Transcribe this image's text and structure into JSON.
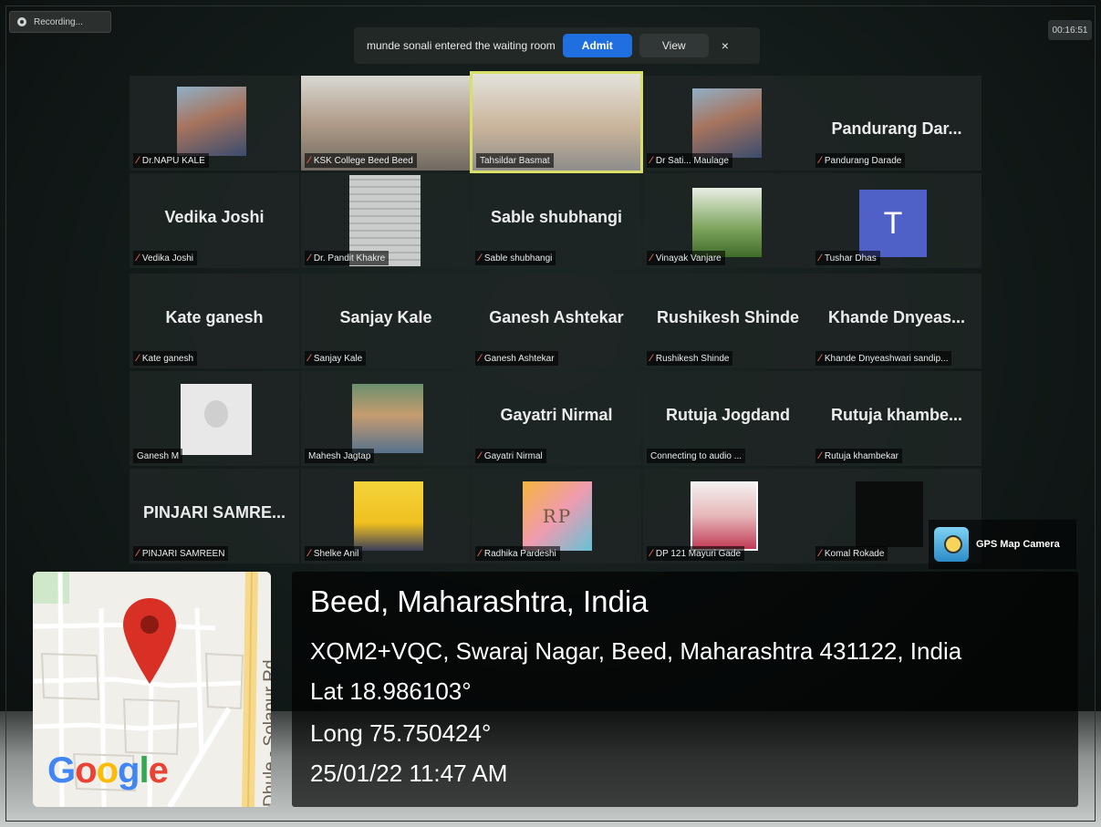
{
  "recording": {
    "label": "Recording..."
  },
  "timer": "00:16:51",
  "waiting_room": {
    "message": "munde sonali entered the waiting room",
    "admit_label": "Admit",
    "view_label": "View",
    "close_symbol": "×"
  },
  "participants": [
    {
      "label": "Dr.NAPU KALE",
      "muted": true
    },
    {
      "label": "KSK College Beed Beed",
      "muted": true
    },
    {
      "label": "Tahsildar Basmat",
      "muted": false,
      "active_speaker": true
    },
    {
      "label": "Dr Sati... Maulage",
      "muted": true
    },
    {
      "big_name": "Pandurang  Dar...",
      "label": "Pandurang Darade",
      "muted": true
    },
    {
      "big_name": "Vedika Joshi",
      "label": "Vedika Joshi",
      "muted": true
    },
    {
      "label": "Dr. Pandit Khakre",
      "muted": true
    },
    {
      "big_name": "Sable shubhangi",
      "label": "Sable shubhangi",
      "muted": true
    },
    {
      "label": "Vinayak Vanjare",
      "muted": true
    },
    {
      "avatar_letter": "T",
      "label": "Tushar Dhas",
      "muted": true
    },
    {
      "big_name": "Kate ganesh",
      "label": "Kate ganesh",
      "muted": true
    },
    {
      "big_name": "Sanjay Kale",
      "label": "Sanjay Kale",
      "muted": true
    },
    {
      "big_name": "Ganesh Ashtekar",
      "label": "Ganesh Ashtekar",
      "muted": true
    },
    {
      "big_name": "Rushikesh Shinde",
      "label": "Rushikesh Shinde",
      "muted": true
    },
    {
      "big_name": "Khande  Dnyeas...",
      "label": "Khande Dnyeashwari sandip...",
      "muted": true
    },
    {
      "label": "Ganesh M",
      "muted": false
    },
    {
      "label": "Mahesh Jagtap",
      "muted": false
    },
    {
      "big_name": "Gayatri Nirmal",
      "label": "Gayatri Nirmal",
      "muted": true
    },
    {
      "big_name": "Rutuja Jogdand",
      "label": "Connecting to audio ...",
      "muted": false
    },
    {
      "big_name": "Rutuja  khambe...",
      "label": "Rutuja khambekar",
      "muted": true
    },
    {
      "big_name": "PINJARI  SAMRE...",
      "label": "PINJARI SAMREEN",
      "muted": true
    },
    {
      "label": "Shelke Anil",
      "muted": true
    },
    {
      "photo_text": "RP",
      "label": "Radhika Pardeshi",
      "muted": true
    },
    {
      "label": "DP 121 Mayuri Gade",
      "muted": true
    },
    {
      "label": "Komal Rokade",
      "muted": true
    }
  ],
  "gps_camera": {
    "label": "GPS Map Camera"
  },
  "map": {
    "brand": "Google",
    "road": "Dhule - Solapur Rd"
  },
  "location": {
    "city": "Beed, Maharashtra, India",
    "address": "XQM2+VQC, Swaraj Nagar, Beed, Maharashtra 431122, India",
    "lat": "Lat 18.986103°",
    "long": "Long 75.750424°",
    "datetime": "25/01/22 11:47 AM"
  },
  "colors": {
    "admit_blue": "#1f6fe0",
    "mute_red": "#e0604a",
    "active_border": "#d8e06a",
    "pin_red": "#d93025"
  }
}
